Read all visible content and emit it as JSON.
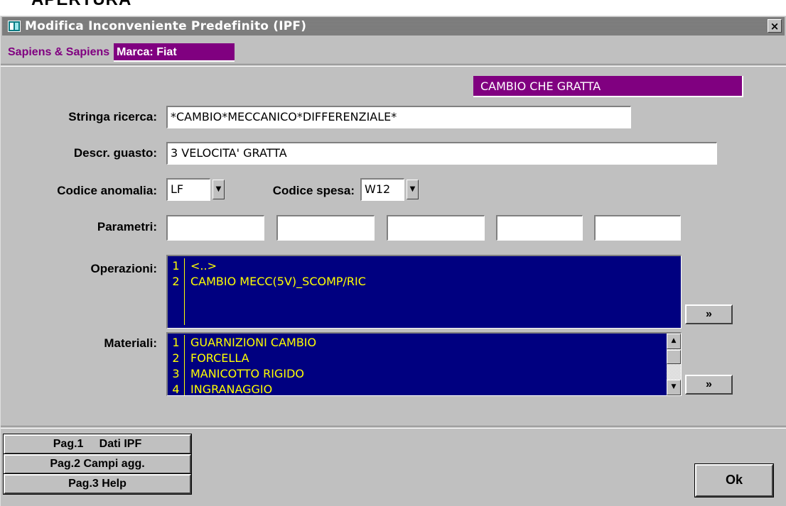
{
  "page_heading": "APERTURA",
  "window": {
    "title": "Modifica Inconveniente Predefinito (IPF)",
    "close_glyph": "×"
  },
  "brand": {
    "name": "Sapiens & Sapiens",
    "marca": "Marca: Fiat"
  },
  "problem_title": "CAMBIO CHE GRATTA",
  "form": {
    "stringa_label": "Stringa ricerca:",
    "stringa_value": "*CAMBIO*MECCANICO*DIFFERENZIALE*",
    "descr_label": "Descr. guasto:",
    "descr_value": "3 VELOCITA' GRATTA",
    "codice_anomalia_label": "Codice anomalia:",
    "codice_anomalia_value": "LF",
    "codice_spesa_label": "Codice spesa:",
    "codice_spesa_value": "W12",
    "parametri_label": "Parametri:",
    "parametri_values": [
      "",
      "",
      "",
      "",
      ""
    ],
    "operazioni_label": "Operazioni:",
    "materiali_label": "Materiali:"
  },
  "operazioni": [
    {
      "num": "1",
      "text": "<..>"
    },
    {
      "num": "2",
      "text": "CAMBIO MECC(5V)_SCOMP/RIC"
    }
  ],
  "materiali": [
    {
      "num": "1",
      "text": "GUARNIZIONI CAMBIO"
    },
    {
      "num": "2",
      "text": "FORCELLA"
    },
    {
      "num": "3",
      "text": "MANICOTTO RIGIDO"
    },
    {
      "num": "4",
      "text": "INGRANAGGIO"
    }
  ],
  "buttons": {
    "more_label": "»",
    "pag1": "Pag.1     Dati IPF",
    "pag2": "Pag.2 Campi agg.",
    "pag3": "Pag.3 Help",
    "ok": "Ok"
  },
  "icons": {
    "app": "form-window-icon",
    "dropdown": "dropdown-arrow-icon",
    "scroll_up": "scroll-up-arrow-icon",
    "scroll_down": "scroll-down-arrow-icon"
  },
  "colors": {
    "window_bg": "#c0c0c0",
    "titlebar": "#808080",
    "brand_purple": "#800080",
    "list_bg": "#000080",
    "list_text": "#ffff00"
  }
}
